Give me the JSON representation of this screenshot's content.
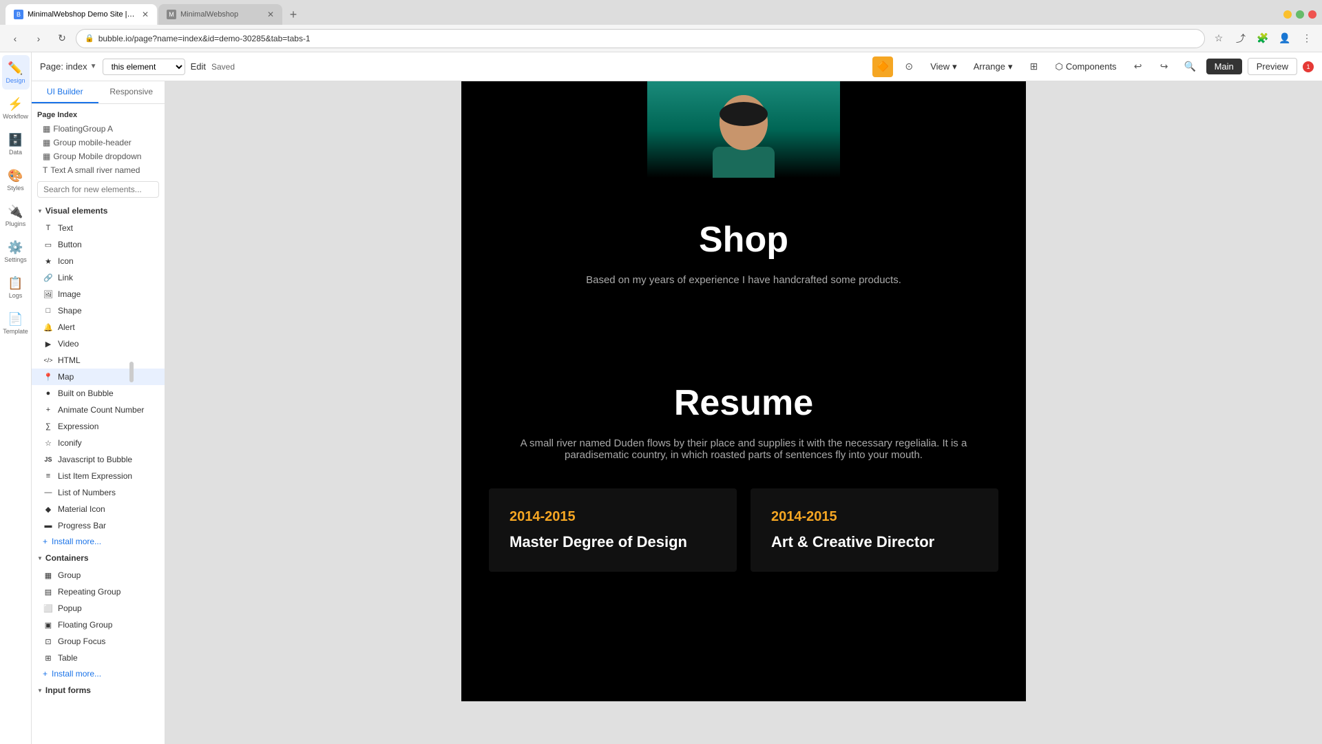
{
  "browser": {
    "tabs": [
      {
        "id": "tab1",
        "label": "MinimalWebshop Demo Site | Bu...",
        "active": true,
        "favicon": "M"
      },
      {
        "id": "tab2",
        "label": "MinimalWebshop",
        "active": false,
        "favicon": "M"
      }
    ],
    "new_tab_label": "+",
    "address": "bubble.io/page?name=index&id=demo-30285&tab=tabs-1",
    "window_controls": [
      "close",
      "min",
      "max"
    ]
  },
  "toolbar": {
    "page_label": "Page: index",
    "element_placeholder": "this element",
    "edit_label": "Edit",
    "saved_label": "Saved",
    "view_label": "View",
    "arrange_label": "Arrange",
    "components_label": "Components",
    "main_label": "Main",
    "preview_label": "Preview",
    "notif_count": "1"
  },
  "icon_sidebar": {
    "items": [
      {
        "id": "design",
        "icon": "✏️",
        "label": "Design",
        "active": true
      },
      {
        "id": "workflow",
        "icon": "⚡",
        "label": "Workflow",
        "active": false
      },
      {
        "id": "data",
        "icon": "🗄️",
        "label": "Data",
        "active": false
      },
      {
        "id": "styles",
        "icon": "🎨",
        "label": "Styles",
        "active": false
      },
      {
        "id": "plugins",
        "icon": "🔌",
        "label": "Plugins",
        "active": false
      },
      {
        "id": "settings",
        "icon": "⚙️",
        "label": "Settings",
        "active": false
      },
      {
        "id": "logs",
        "icon": "📋",
        "label": "Logs",
        "active": false
      },
      {
        "id": "template",
        "icon": "📄",
        "label": "Template",
        "active": false
      }
    ]
  },
  "left_panel": {
    "tabs": [
      {
        "id": "ui-builder",
        "label": "UI Builder",
        "active": true
      },
      {
        "id": "responsive",
        "label": "Responsive",
        "active": false
      }
    ],
    "page_index_label": "Page Index",
    "tree_items": [
      {
        "id": "floating-group-a",
        "label": "FloatingGroup A"
      },
      {
        "id": "group-mobile-header",
        "label": "Group mobile-header"
      },
      {
        "id": "group-mobile-dropdown",
        "label": "Group Mobile dropdown"
      },
      {
        "id": "text-a-small-river",
        "label": "Text A small river named"
      }
    ],
    "search_placeholder": "Search for new elements...",
    "visual_elements_header": "Visual elements",
    "visual_elements": [
      {
        "id": "text",
        "label": "Text",
        "icon": "T"
      },
      {
        "id": "button",
        "label": "Button",
        "icon": "▭"
      },
      {
        "id": "icon",
        "label": "Icon",
        "icon": "★"
      },
      {
        "id": "link",
        "label": "Link",
        "icon": "🔗"
      },
      {
        "id": "image",
        "label": "Image",
        "icon": "🖼"
      },
      {
        "id": "shape",
        "label": "Shape",
        "icon": "□"
      },
      {
        "id": "alert",
        "label": "Alert",
        "icon": "🔔"
      },
      {
        "id": "video",
        "label": "Video",
        "icon": "▶"
      },
      {
        "id": "html",
        "label": "HTML",
        "icon": "<>"
      },
      {
        "id": "map",
        "label": "Map",
        "icon": "📍"
      },
      {
        "id": "built-on-bubble",
        "label": "Built on Bubble",
        "icon": "●"
      },
      {
        "id": "animate-count-number",
        "label": "Animate Count Number",
        "icon": "#"
      },
      {
        "id": "expression",
        "label": "Expression",
        "icon": "∑"
      },
      {
        "id": "iconify",
        "label": "Iconify",
        "icon": "☆"
      },
      {
        "id": "javascript-to-bubble",
        "label": "Javascript to Bubble",
        "icon": "JS"
      },
      {
        "id": "list-item-expression",
        "label": "List Item Expression",
        "icon": "≡"
      },
      {
        "id": "list-of-numbers",
        "label": "List of Numbers",
        "icon": "—"
      },
      {
        "id": "material-icon",
        "label": "Material Icon",
        "icon": "◆"
      },
      {
        "id": "progress-bar",
        "label": "Progress Bar",
        "icon": "▬"
      },
      {
        "id": "install-more-visual",
        "label": "Install more...",
        "icon": "+"
      }
    ],
    "containers_header": "Containers",
    "containers": [
      {
        "id": "group",
        "label": "Group",
        "icon": "▦"
      },
      {
        "id": "repeating-group",
        "label": "Repeating Group",
        "icon": "▤"
      },
      {
        "id": "popup",
        "label": "Popup",
        "icon": "⬜"
      },
      {
        "id": "floating-group",
        "label": "Floating Group",
        "icon": "▣"
      },
      {
        "id": "group-focus",
        "label": "Group Focus",
        "icon": "⊡"
      },
      {
        "id": "table",
        "label": "Table",
        "icon": "⊞"
      },
      {
        "id": "install-more-containers",
        "label": "Install more...",
        "icon": "+"
      }
    ],
    "input_forms_header": "Input forms"
  },
  "canvas": {
    "shop_title": "Shop",
    "shop_subtitle": "Based on my years of experience I have handcrafted some products.",
    "resume_title": "Resume",
    "resume_subtitle": "A small river named Duden flows by their place and supplies it with the necessary regelialia. It is a paradisematic country, in which roasted parts of sentences fly into your mouth.",
    "resume_cards": [
      {
        "year": "2014-2015",
        "title": "Master Degree of Design"
      },
      {
        "year": "2014-2015",
        "title": "Art & Creative Director"
      }
    ]
  }
}
